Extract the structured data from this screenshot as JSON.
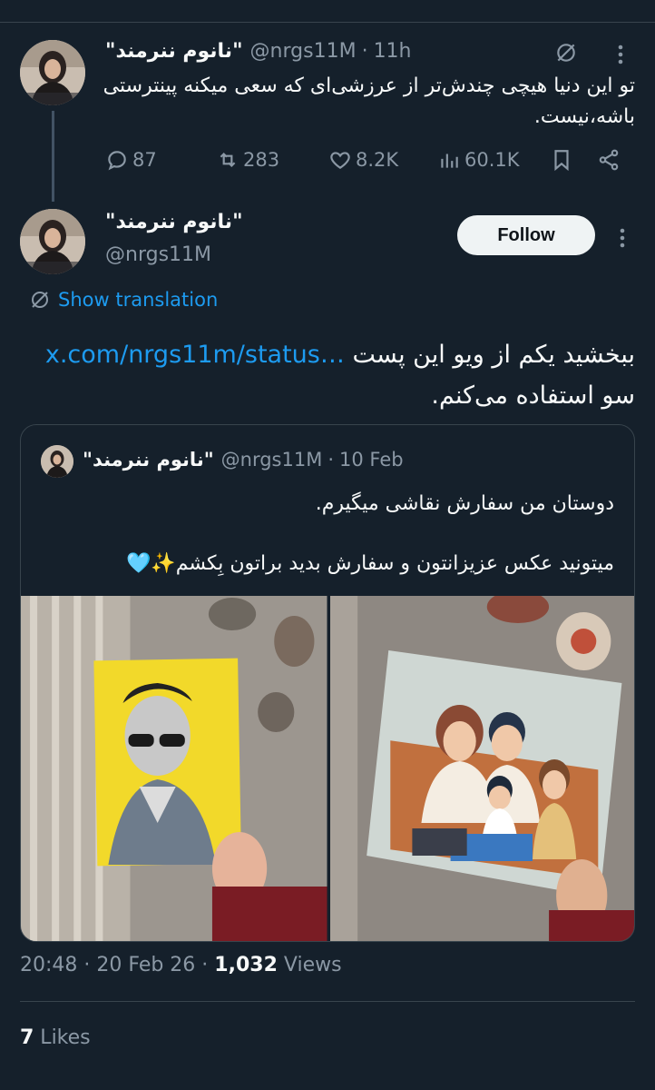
{
  "parent_tweet": {
    "display_name": "\"نانوم ننرمند\"",
    "handle": "@nrgs11M",
    "time": "11h",
    "text": "تو این دنیا هیچی چندش‌تر از عرزشی‌ای که سعی میکنه پینترستی باشه،نیست.",
    "stats": {
      "replies": "87",
      "reposts": "283",
      "likes": "8.2K",
      "views": "60.1K"
    }
  },
  "main_tweet": {
    "display_name": "\"نانوم ننرمند\"",
    "handle": "@nrgs11M",
    "follow_label": "Follow",
    "show_translation": "Show translation",
    "text_before_link": "ببخشید یکم از ویو این پست",
    "link": "x.com/nrgs11m/status…",
    "text_after_link": "سو استفاده می‌کنم.",
    "timestamp": "20:48 · 20 Feb 26 · ",
    "views_count": "1,032",
    "views_label": " Views",
    "likes_count": "7",
    "likes_label": " Likes"
  },
  "quoted_tweet": {
    "display_name": "\"نانوم ننرمند\"",
    "handle": "@nrgs11M",
    "date": "10 Feb",
    "line1": "دوستان من سفارش نقاشی میگیرم.",
    "line2": "میتونید عکس عزیزانتون و سفارش بدید براتون بِکشم✨🩵"
  }
}
